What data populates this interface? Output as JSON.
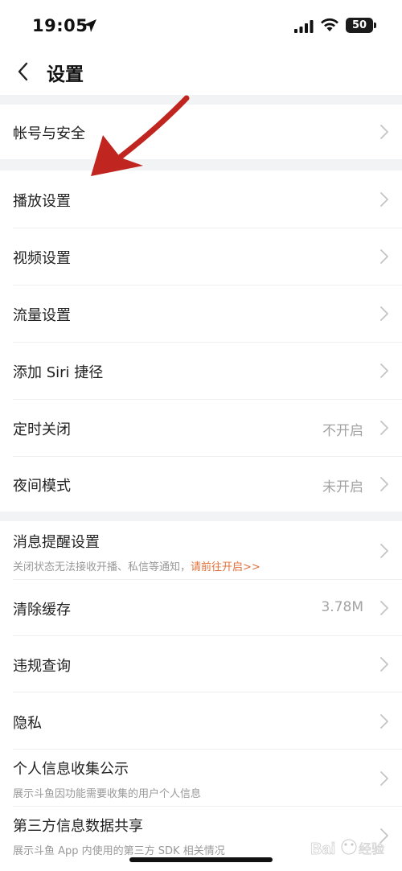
{
  "status_bar": {
    "time": "19:05",
    "battery": "50"
  },
  "nav": {
    "title": "设置"
  },
  "items": [
    {
      "label": "帐号与安全"
    },
    {
      "label": "播放设置"
    },
    {
      "label": "视频设置"
    },
    {
      "label": "流量设置"
    },
    {
      "label": "添加 Siri 捷径"
    },
    {
      "label": "定时关闭",
      "value": "不开启"
    },
    {
      "label": "夜间模式",
      "value": "未开启"
    },
    {
      "label": "消息提醒设置",
      "subtitle": "关闭状态无法接收开播、私信等通知，",
      "subtitle_link": "请前往开启>>"
    },
    {
      "label": "清除缓存",
      "value": "3.78M"
    },
    {
      "label": "违规查询"
    },
    {
      "label": "隐私"
    },
    {
      "label": "个人信息收集公示",
      "subtitle": "展示斗鱼因功能需要收集的用户个人信息"
    },
    {
      "label": "第三方信息数据共享",
      "subtitle": "展示斗鱼 App 内使用的第三方 SDK 相关情况"
    }
  ],
  "watermark": "Bai 经验",
  "colors": {
    "background_gap": "#f2f3f5",
    "link": "#e0703a",
    "arrow": "#c0251f"
  }
}
